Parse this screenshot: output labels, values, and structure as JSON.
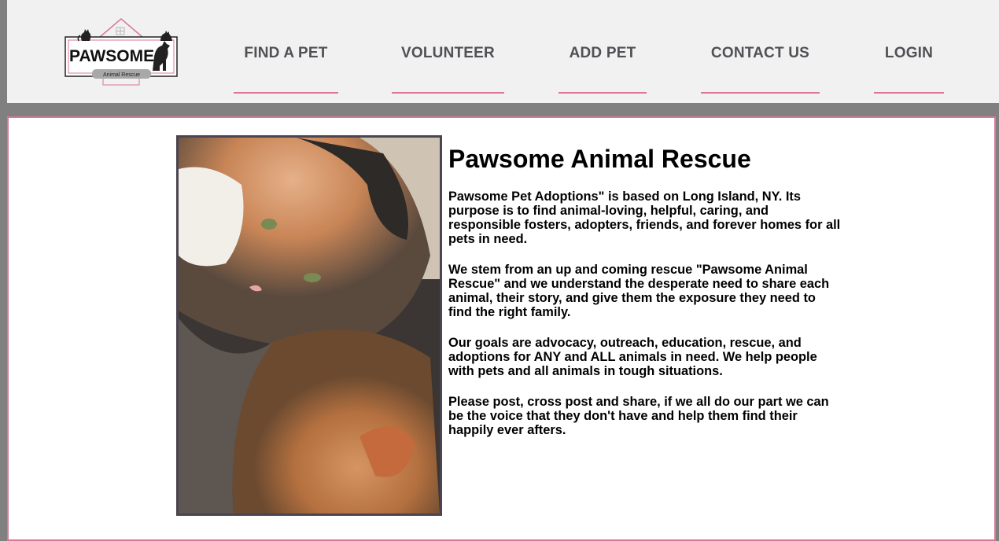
{
  "logo": {
    "name": "PAWSOME",
    "tagline": "Animal Rescue"
  },
  "nav": {
    "items": [
      {
        "label": "FIND A PET"
      },
      {
        "label": "VOLUNTEER"
      },
      {
        "label": "ADD PET"
      },
      {
        "label": "CONTACT US"
      },
      {
        "label": "LOGIN"
      }
    ]
  },
  "main": {
    "title": "Pawsome Animal Rescue",
    "paragraphs": [
      "Pawsome Pet Adoptions\" is based on Long Island, NY. Its purpose is to find animal-loving, helpful, caring, and responsible fosters, adopters, friends, and forever homes for all pets in need.",
      "We stem from an up and coming rescue \"Pawsome Animal Rescue\" and we understand the desperate need to share each animal, their story, and give them the exposure they need to find the right family.",
      "Our goals are advocacy, outreach, education, rescue, and adoptions for ANY and ALL animals in need. We help people with pets and all animals in tough situations.",
      "Please post, cross post and share, if we all do our part we can be the voice that they don't have and help them find their happily ever afters."
    ]
  },
  "colors": {
    "accent": "#d9779a",
    "header_bg": "#f1f1f1",
    "nav_text": "#505055",
    "page_bg": "#808080"
  }
}
